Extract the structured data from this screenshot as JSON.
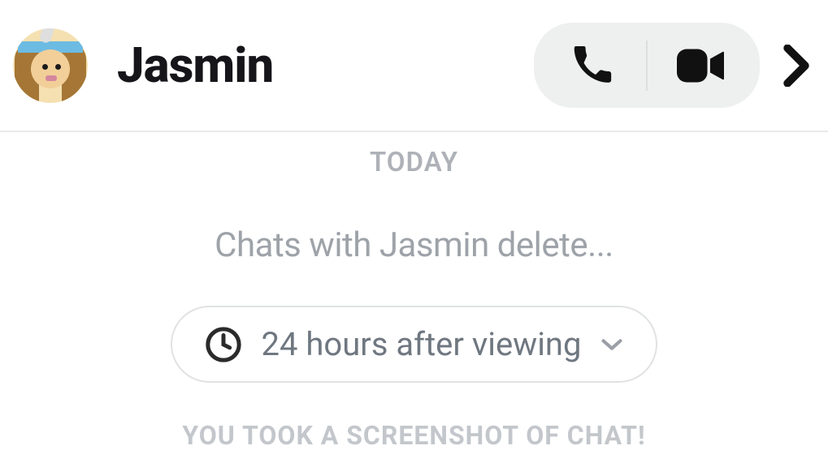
{
  "header": {
    "contact_name": "Jasmin"
  },
  "chat": {
    "date_label": "TODAY",
    "delete_notice": "Chats with Jasmin delete...",
    "setting_label": "24 hours after viewing",
    "screenshot_banner": "YOU TOOK A SCREENSHOT OF CHAT!"
  },
  "icons": {
    "phone": "phone-icon",
    "video": "video-icon",
    "more": "chevron-right-icon",
    "clock": "clock-icon",
    "expand": "chevron-down-icon"
  }
}
